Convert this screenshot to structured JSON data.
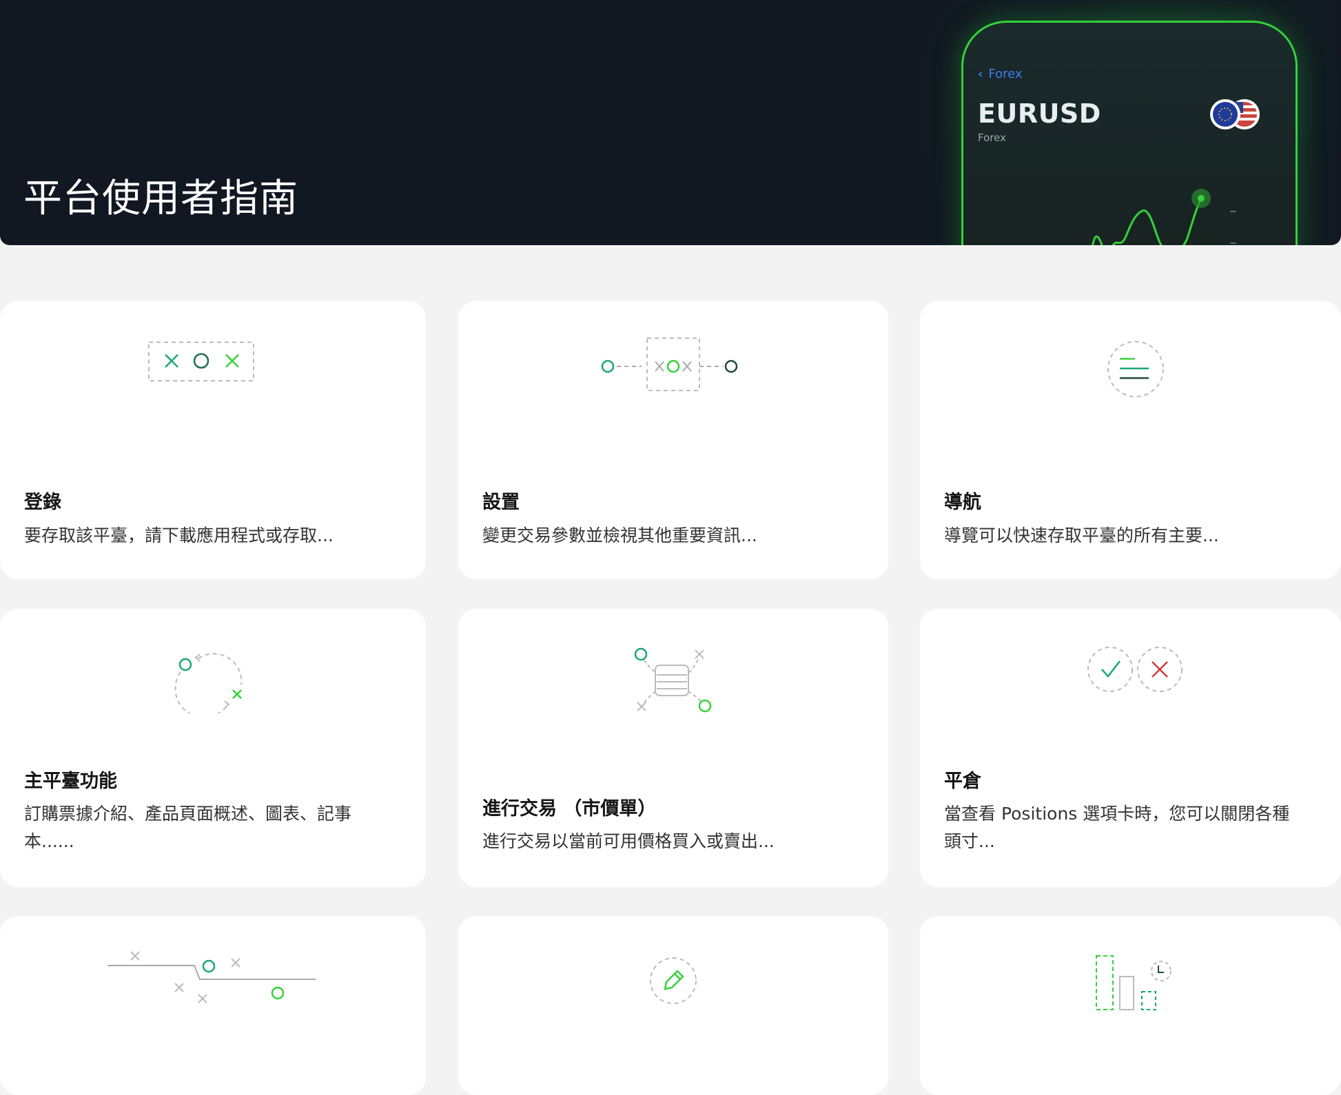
{
  "hero": {
    "title": "平台使用者指南",
    "phone": {
      "back_label": "Forex",
      "symbol": "EURUSD",
      "category": "Forex"
    }
  },
  "cards": [
    {
      "title": "登錄",
      "description": "要存取該平臺，請下載應用程式或存取..."
    },
    {
      "title": "設置",
      "description": "變更交易參數並檢視其他重要資訊..."
    },
    {
      "title": "導航",
      "description": "導覽可以快速存取平臺的所有主要..."
    },
    {
      "title": "主平臺功能",
      "description": "訂購票據介紹、產品頁面概述、圖表、記事本......"
    },
    {
      "title": "進行交易 （市價單）",
      "description": "進行交易以當前可用價格買入或賣出..."
    },
    {
      "title": "平倉",
      "description": "當查看 Positions 選項卡時，您可以關閉各種頭寸..."
    }
  ],
  "colors": {
    "hero_bg": "#111821",
    "accent_green": "#35d13a",
    "teal_green": "#1ba672",
    "close_red": "#d03a3a",
    "link_blue": "#3d7df0"
  }
}
